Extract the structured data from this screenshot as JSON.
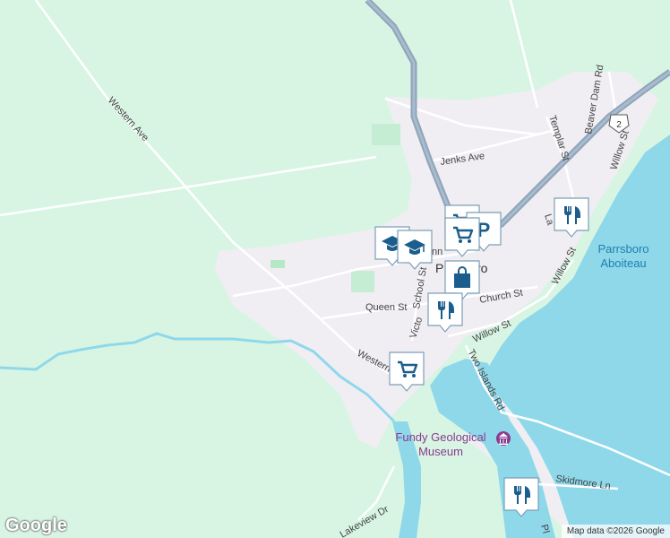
{
  "labels": {
    "western_ave_nw": "Western Ave",
    "western_ave_s": "Western",
    "jenks_ave": "Jenks Ave",
    "templar_st": "Templar St",
    "beaver_dam_rd": "Beaver Dam Rd",
    "willow_st_ne": "Willow St",
    "willow_st_mid": "Willow St",
    "willow_st_s": "Willow St",
    "queen_st": "Queen St",
    "school_st": "School St",
    "church_st": "Church St",
    "victoria_st": "Victo",
    "two_islands_rd": "Two Islands Rd",
    "skidmore_ln": "Skidmore Ln",
    "lakeview_dr": "Lakeview Dr",
    "la_partial": "La",
    "pl_partial": "Pl",
    "inn_partial": "nn",
    "town": "Parrsboro",
    "town_p": "P",
    "town_tail": "ro",
    "aboiteau_1": "Parrsboro",
    "aboiteau_2": "Aboiteau",
    "museum_1": "Fundy Geological",
    "museum_2": "Museum",
    "route_shield": "2"
  },
  "markers": [
    {
      "icon": "shopping-cart-icon",
      "name": "marker-grocery-north"
    },
    {
      "icon": "parking-icon",
      "name": "marker-parking"
    },
    {
      "icon": "shopping-cart-icon",
      "name": "marker-grocery-center"
    },
    {
      "icon": "school-icon",
      "name": "marker-school-1"
    },
    {
      "icon": "school-icon",
      "name": "marker-school-2"
    },
    {
      "icon": "shopping-bag-icon",
      "name": "marker-store"
    },
    {
      "icon": "restaurant-icon",
      "name": "marker-restaurant-center"
    },
    {
      "icon": "shopping-cart-icon",
      "name": "marker-grocery-south"
    },
    {
      "icon": "restaurant-icon",
      "name": "marker-restaurant-east"
    },
    {
      "icon": "restaurant-icon",
      "name": "marker-restaurant-south"
    }
  ],
  "attribution": "Map data ©2026 Google",
  "logo": "Google",
  "colors": {
    "land": "#d8f5e4",
    "town": "#f1eef3",
    "water": "#8fd8ea",
    "highway": "#8fa4ba",
    "marker": "#1b5d8c",
    "park": "#c5edd3"
  }
}
